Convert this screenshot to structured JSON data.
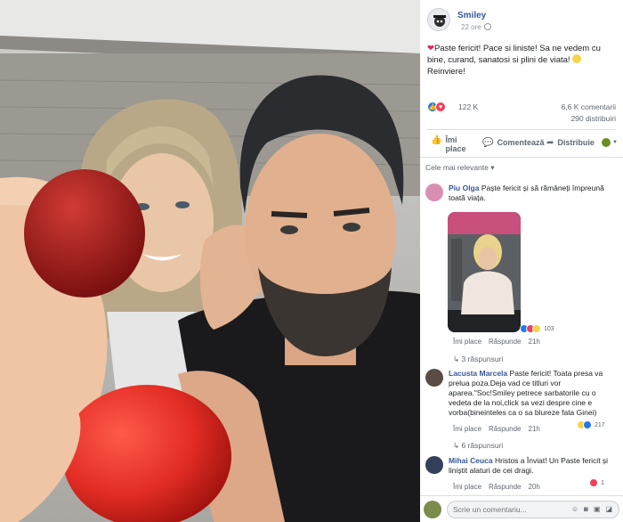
{
  "post": {
    "page_name": "Smiley",
    "time": "22 ore",
    "caption_prefix": "❤",
    "caption": "Paste fericit! Pace si liniste! Sa ne vedem cu bine, curand, sanatosi si plini de viata!",
    "caption_suffix": "Reinviere!",
    "reactions_count": "122 K",
    "comments_count": "6,6 K comentarii",
    "shares_count": "290 distribuiri"
  },
  "actions": {
    "like": "Îmi place",
    "comment": "Comentează",
    "share": "Distribuie"
  },
  "sort_label": "Cele mai relevante",
  "comments": [
    {
      "author": "Piu Olga",
      "text": "Paște fericit și să rămâneți împreună toată viața.",
      "like_label": "Îmi place",
      "reply_label": "Răspunde",
      "time": "21h",
      "reactions": "103",
      "replies": "3 răspunsuri"
    },
    {
      "author": "Lacusta Marcela",
      "text": "Paste fericit! Toata presa va prelua poza.Deja vad ce titluri vor aparea.\"Soc!Smiley petrece sarbatorile cu o vedeta de la noi,click sa vezi despre cine e vorba(bineinteles ca o sa blureze fata Ginei)",
      "like_label": "Îmi place",
      "reply_label": "Răspunde",
      "time": "21h",
      "reactions": "217",
      "replies": "6 răspunsuri"
    },
    {
      "author": "Mihai Ceuca",
      "text": "Hristos a Înviat! Un Paste fericit și liniștit alaturi de cei dragi.",
      "like_label": "Îmi place",
      "reply_label": "Răspunde",
      "time": "20h",
      "reactions": "1"
    }
  ],
  "composer": {
    "placeholder": "Scrie un comentariu..."
  },
  "colors": {
    "link_blue": "#385898",
    "like_blue": "#2078f4",
    "love_red": "#f33e58",
    "egg_red": "#e8312b"
  }
}
